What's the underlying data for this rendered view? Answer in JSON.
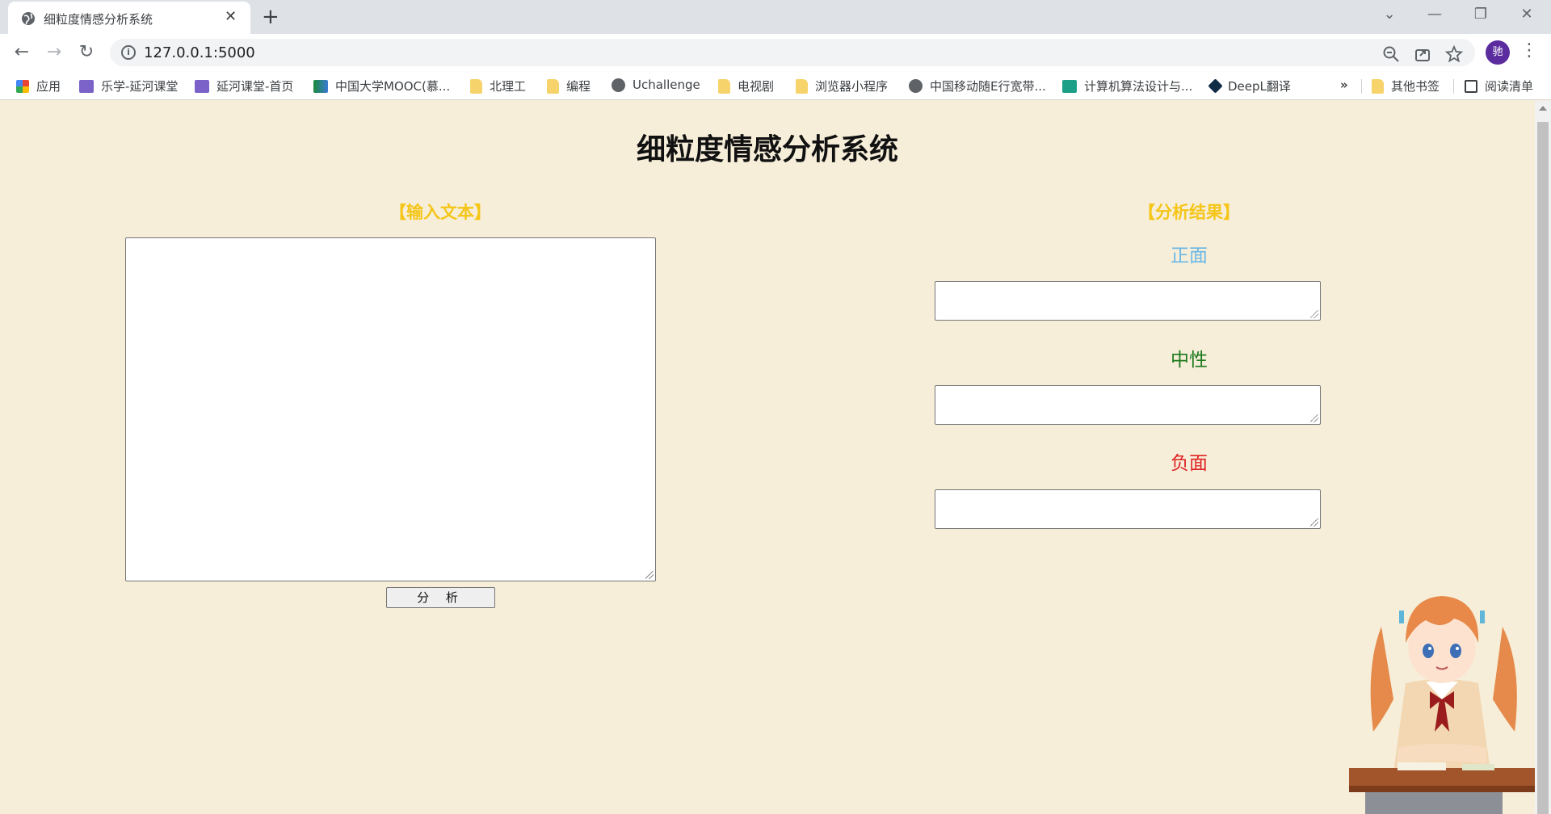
{
  "browser": {
    "tab": {
      "title": "细粒度情感分析系统",
      "icon": "globe-icon"
    },
    "new_tab_symbol": "+",
    "window_controls": {
      "dropdown": "⌄",
      "minimize": "—",
      "restore": "❐",
      "close": "✕"
    },
    "nav": {
      "back": "←",
      "forward": "→",
      "reload": "↻"
    },
    "url": "127.0.0.1:5000",
    "profile_initial": "驰",
    "bookmarks": [
      {
        "label": "应用",
        "icon": "apps-icon"
      },
      {
        "label": "乐学-延河课堂",
        "icon": "yanhe-icon"
      },
      {
        "label": "延河课堂-首页",
        "icon": "yanhe-icon"
      },
      {
        "label": "中国大学MOOC(慕...",
        "icon": "mooc-icon"
      },
      {
        "label": "北理工",
        "icon": "folder-icon"
      },
      {
        "label": "编程",
        "icon": "folder-icon"
      },
      {
        "label": "Uchallenge",
        "icon": "globe-icon"
      },
      {
        "label": "电视剧",
        "icon": "folder-icon"
      },
      {
        "label": "浏览器小程序",
        "icon": "folder-icon"
      },
      {
        "label": "中国移动随E行宽带...",
        "icon": "globe-icon"
      },
      {
        "label": "计算机算法设计与...",
        "icon": "calendar-icon"
      },
      {
        "label": "DeepL翻译",
        "icon": "deepl-icon"
      }
    ],
    "overflow_symbol": "»",
    "other_bookmarks": "其他书签",
    "reading_list": "阅读清单"
  },
  "page": {
    "title": "细粒度情感分析系统",
    "input_heading": "【输入文本】",
    "input_value": "",
    "analyze_button": "分 析",
    "result_heading": "【分析结果】",
    "results": [
      {
        "label": "正面",
        "color": "#6cb8e6",
        "value": ""
      },
      {
        "label": "中性",
        "color": "#1e7a1e",
        "value": ""
      },
      {
        "label": "负面",
        "color": "#e02424",
        "value": ""
      }
    ]
  }
}
